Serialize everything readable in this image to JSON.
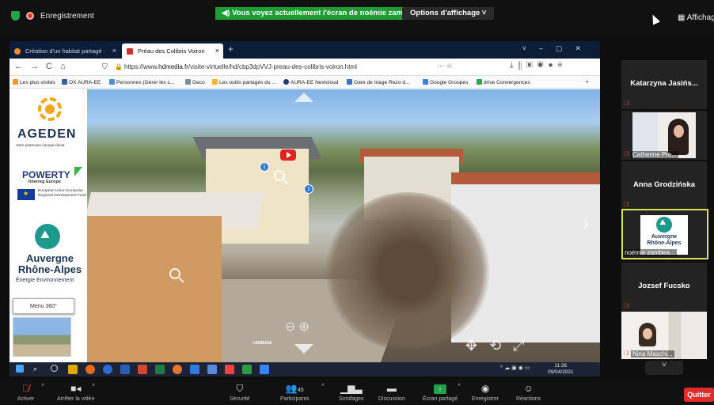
{
  "topbar": {
    "recording_label": "Enregistrement",
    "share_banner": "Vous voyez actuellement l'écran de noémie zambeaux",
    "view_options": "Options d'affichage ˅",
    "gallery_label": "Affichage"
  },
  "browser": {
    "tabs": [
      {
        "label": "Création d'un habitat partagé ·"
      },
      {
        "label": "Préau des Colibris Voiron"
      }
    ],
    "url_prefix": "https://www.",
    "url_domain": "hdmedia.fr",
    "url_path": "/visite-virtuelle/hd/cbp3dpVVJ-preau-des-colibris-voiron.html",
    "url_extras": "··· ☆",
    "bookmarks": [
      "Les plus visités",
      "OX AURA-EE",
      "Personnes (Gérer les c...",
      "Geco",
      "Les outils partagés du ...",
      "AURA-EE Nextcloud",
      "Gare de triage Rezo d...",
      "Google Groupes",
      "drive Convergences"
    ]
  },
  "sidebar": {
    "ageden": "AGEDEN",
    "ageden_sub": "Votre partenaire énergie-climat",
    "poweryt": "POWERTY",
    "interreg": "Interreg Europe",
    "eu_text": "European Union European Regional Development Fund",
    "ara_name": "Auvergne Rhône-Alpes",
    "ara_sub": "Énergie Environnement",
    "menu360": "Menu 360°"
  },
  "pano": {
    "watermark": "HDMEDIA"
  },
  "taskbar": {
    "time": "11:26",
    "date": "09/04/2021"
  },
  "participants": [
    {
      "name": "Katarzyna Jasińs...",
      "muted": true
    },
    {
      "name": "Catherine Pre...",
      "muted": true
    },
    {
      "name": "Anna Grodzińska",
      "muted": true
    },
    {
      "name": "noémie zambea...",
      "logo_line1": "Auvergne",
      "logo_line2": "Rhône-Alpes"
    },
    {
      "name": "Jozsef Fucsko",
      "muted": true
    },
    {
      "name": "Nina Maschi...",
      "muted": true
    }
  ],
  "toolbar": {
    "activate": "Activer",
    "stop_video": "Arrêter la vidéo",
    "security": "Sécurité",
    "participants": "Participants",
    "participants_count": "45",
    "polls": "Sondages",
    "chat": "Discussion",
    "share": "Écran partagé",
    "record": "Enregistrer",
    "reactions": "Réactions",
    "quit": "Quitter"
  },
  "colors": {
    "share_green": "#1f9d35",
    "quit_red": "#e22c2c",
    "active_speaker": "#d9e34f"
  }
}
